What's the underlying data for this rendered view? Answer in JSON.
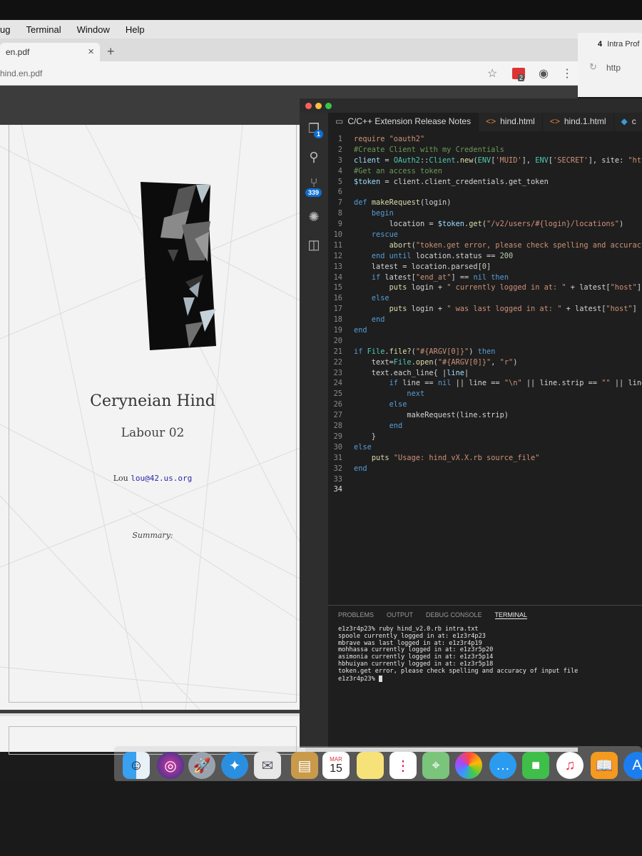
{
  "menubar": {
    "items": [
      "ug",
      "Terminal",
      "Window",
      "Help"
    ]
  },
  "browser": {
    "tab_title": "en.pdf",
    "url": "hind.en.pdf",
    "extension_badge": "2"
  },
  "document": {
    "title": "Ceryneian Hind",
    "subtitle": "Labour 02",
    "author_name": "Lou",
    "author_email": "lou@42.us.org",
    "summary_label": "Summary:"
  },
  "browser2": {
    "tab_title": "Intra Prof",
    "url": "http"
  },
  "vscode": {
    "tabs": [
      {
        "label": "C/C++ Extension Release Notes",
        "icon": "doc-icon"
      },
      {
        "label": "hind.html",
        "icon": "html-icon"
      },
      {
        "label": "hind.1.html",
        "icon": "html-icon"
      },
      {
        "label": "c",
        "icon": "file-icon"
      }
    ],
    "badges": {
      "explorer": "1",
      "source_control": "339"
    },
    "code_lines": [
      [
        [
          "t-str",
          "require \"oauth2\""
        ]
      ],
      [
        [
          "t-cm",
          "#Create Client with my Credentials"
        ]
      ],
      [
        [
          "t-var",
          "client"
        ],
        [
          "txt",
          " = "
        ],
        [
          "t-cls",
          "OAuth2"
        ],
        [
          "txt",
          "::"
        ],
        [
          "t-cls",
          "Client"
        ],
        [
          "txt",
          "."
        ],
        [
          "t-fn",
          "new"
        ],
        [
          "txt",
          "("
        ],
        [
          "t-cls",
          "ENV"
        ],
        [
          "txt",
          "["
        ],
        [
          "t-str",
          "'MUID'"
        ],
        [
          "txt",
          "], "
        ],
        [
          "t-cls",
          "ENV"
        ],
        [
          "txt",
          "["
        ],
        [
          "t-str",
          "'SECRET'"
        ],
        [
          "txt",
          "], site: "
        ],
        [
          "t-str",
          "\"htt"
        ]
      ],
      [
        [
          "t-cm",
          "#Get an access token"
        ]
      ],
      [
        [
          "t-var",
          "$token"
        ],
        [
          "txt",
          " = client.client_credentials.get_token"
        ]
      ],
      [
        [
          "txt",
          ""
        ]
      ],
      [
        [
          "t-kw",
          "def "
        ],
        [
          "t-fn",
          "makeRequest"
        ],
        [
          "txt",
          "(login)"
        ]
      ],
      [
        [
          "txt",
          "    "
        ],
        [
          "t-kw",
          "begin"
        ]
      ],
      [
        [
          "txt",
          "        location = "
        ],
        [
          "t-var",
          "$token"
        ],
        [
          "txt",
          "."
        ],
        [
          "t-fn",
          "get"
        ],
        [
          "txt",
          "("
        ],
        [
          "t-str",
          "\"/v2/users/#{login}/locations\""
        ],
        [
          "txt",
          ")"
        ]
      ],
      [
        [
          "txt",
          "    "
        ],
        [
          "t-kw",
          "rescue"
        ]
      ],
      [
        [
          "txt",
          "        "
        ],
        [
          "t-fn",
          "abort"
        ],
        [
          "txt",
          "("
        ],
        [
          "t-str",
          "\"token.get error, please check spelling and accuracy o"
        ]
      ],
      [
        [
          "txt",
          "    "
        ],
        [
          "t-kw",
          "end until "
        ],
        [
          "txt",
          "location.status == "
        ],
        [
          "t-num",
          "200"
        ]
      ],
      [
        [
          "txt",
          "    latest = location.parsed["
        ],
        [
          "t-num",
          "0"
        ],
        [
          "txt",
          "]"
        ]
      ],
      [
        [
          "txt",
          "    "
        ],
        [
          "t-kw",
          "if "
        ],
        [
          "txt",
          "latest["
        ],
        [
          "t-str",
          "\"end_at\""
        ],
        [
          "txt",
          "] == "
        ],
        [
          "t-kw",
          "nil then"
        ]
      ],
      [
        [
          "txt",
          "        "
        ],
        [
          "t-fn",
          "puts"
        ],
        [
          "txt",
          " login + "
        ],
        [
          "t-str",
          "\" currently logged in at: \""
        ],
        [
          "txt",
          " + latest["
        ],
        [
          "t-str",
          "\"host\""
        ],
        [
          "txt",
          "]"
        ]
      ],
      [
        [
          "txt",
          "    "
        ],
        [
          "t-kw",
          "else"
        ]
      ],
      [
        [
          "txt",
          "        "
        ],
        [
          "t-fn",
          "puts"
        ],
        [
          "txt",
          " login + "
        ],
        [
          "t-str",
          "\" was last logged in at: \""
        ],
        [
          "txt",
          " + latest["
        ],
        [
          "t-str",
          "\"host\""
        ],
        [
          "txt",
          "]"
        ]
      ],
      [
        [
          "txt",
          "    "
        ],
        [
          "t-kw",
          "end"
        ]
      ],
      [
        [
          "t-kw",
          "end"
        ]
      ],
      [
        [
          "txt",
          ""
        ]
      ],
      [
        [
          "t-kw",
          "if "
        ],
        [
          "t-cls",
          "File"
        ],
        [
          "txt",
          "."
        ],
        [
          "t-fn",
          "file?"
        ],
        [
          "txt",
          "("
        ],
        [
          "t-str",
          "\"#{ARGV[0]}\""
        ],
        [
          "txt",
          ") "
        ],
        [
          "t-kw",
          "then"
        ]
      ],
      [
        [
          "txt",
          "    text="
        ],
        [
          "t-cls",
          "File"
        ],
        [
          "txt",
          "."
        ],
        [
          "t-fn",
          "open"
        ],
        [
          "txt",
          "("
        ],
        [
          "t-str",
          "\"#{ARGV[0]}\""
        ],
        [
          "txt",
          ", "
        ],
        [
          "t-str",
          "\"r\""
        ],
        [
          "txt",
          ")"
        ]
      ],
      [
        [
          "txt",
          "    text.each_line{ |"
        ],
        [
          "t-var",
          "line"
        ],
        [
          "txt",
          "|"
        ]
      ],
      [
        [
          "txt",
          "        "
        ],
        [
          "t-kw",
          "if "
        ],
        [
          "txt",
          "line == "
        ],
        [
          "t-kw",
          "nil "
        ],
        [
          "txt",
          "|| line == "
        ],
        [
          "t-str",
          "\"\\n\""
        ],
        [
          "txt",
          " || line.strip == "
        ],
        [
          "t-str",
          "\"\""
        ],
        [
          "txt",
          " || line.str"
        ]
      ],
      [
        [
          "txt",
          "            "
        ],
        [
          "t-kw",
          "next"
        ]
      ],
      [
        [
          "txt",
          "        "
        ],
        [
          "t-kw",
          "else"
        ]
      ],
      [
        [
          "txt",
          "            makeRequest(line.strip)"
        ]
      ],
      [
        [
          "txt",
          "        "
        ],
        [
          "t-kw",
          "end"
        ]
      ],
      [
        [
          "txt",
          "    }"
        ]
      ],
      [
        [
          "t-kw",
          "else"
        ]
      ],
      [
        [
          "txt",
          "    "
        ],
        [
          "t-fn",
          "puts"
        ],
        [
          "txt",
          " "
        ],
        [
          "t-str",
          "\"Usage: hind_vX.X.rb source_file\""
        ]
      ],
      [
        [
          "t-kw",
          "end"
        ]
      ],
      [
        [
          "txt",
          ""
        ]
      ],
      [
        [
          "txt",
          ""
        ]
      ]
    ],
    "panel_tabs": [
      "PROBLEMS",
      "OUTPUT",
      "DEBUG CONSOLE",
      "TERMINAL"
    ],
    "terminal_lines": [
      "e1z3r4p23% ruby hind_v2.0.rb intra.txt",
      "spoole currently logged in at: e1z3r4p23",
      "mbrave was last logged in at: e1z3r4p19",
      "mohhassa currently logged in at: e1z3r5p20",
      "asimonia currently logged in at: e1z3r5p14",
      "hbhuiyan currently logged in at: e1z3r5p18",
      "token.get error, please check spelling and accuracy of input file",
      "e1z3r4p23% "
    ]
  },
  "dock": {
    "calendar_month": "MAR",
    "calendar_day": "15",
    "icons": [
      "finder-icon",
      "siri-icon",
      "launchpad-icon",
      "safari-icon",
      "mail-icon",
      "notes-icon",
      "calendar-icon",
      "stickies-icon",
      "reminders-icon",
      "maps-icon",
      "photos-icon",
      "messages-icon",
      "facetime-icon",
      "itunes-icon",
      "books-icon",
      "appstore-icon"
    ]
  }
}
